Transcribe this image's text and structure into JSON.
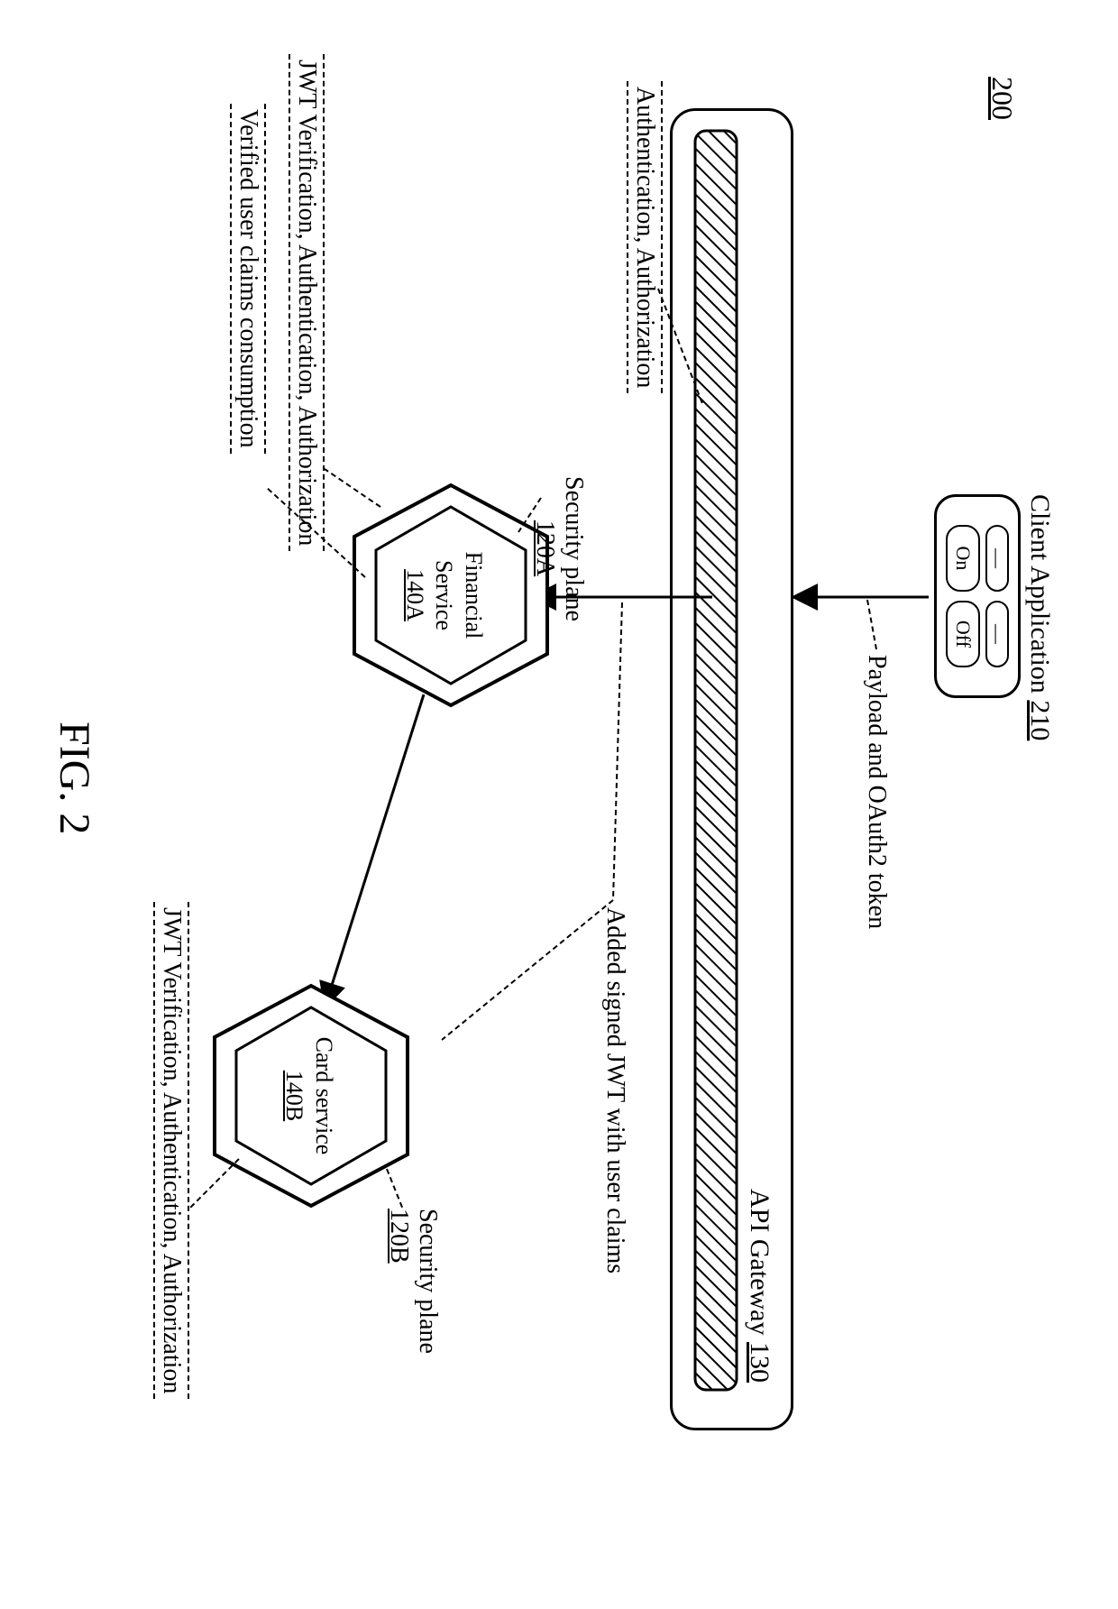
{
  "figure": {
    "ref": "200",
    "title": "FIG. 2"
  },
  "client": {
    "title": "Client Application",
    "ref": "210",
    "button_on": "On",
    "button_off": "Off"
  },
  "arrow1": {
    "label": "Payload and OAuth2 token"
  },
  "gateway": {
    "label": "API Gateway",
    "ref": "130",
    "annotation": "Authentication, Authorization"
  },
  "arrow2": {
    "label": "Added signed JWT with user claims"
  },
  "serviceA": {
    "name_line1": "Financial",
    "name_line2": "Service",
    "ref": "140A",
    "plane_label": "Security plane",
    "plane_ref": "120A",
    "annotation": "JWT Verification, Authentication, Authorization",
    "extra": "Verified user claims consumption"
  },
  "serviceB": {
    "name_line1": "Card service",
    "ref": "140B",
    "plane_label": "Security plane",
    "plane_ref": "120B",
    "annotation": "JWT Verification, Authentication, Authorization"
  }
}
